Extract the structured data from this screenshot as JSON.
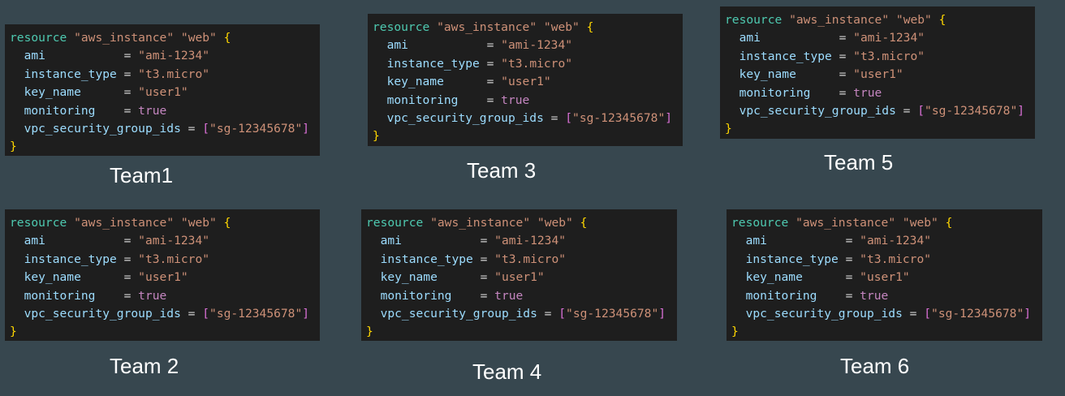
{
  "colors": {
    "background": "#37474f",
    "panel": "#1e1e1e",
    "keyword": "#4ec9b0",
    "identifier": "#9cdcfe",
    "string": "#ce9178",
    "boolean": "#c586c0",
    "brace": "#ffd700",
    "bracket": "#da70d6",
    "caption": "#ffffff"
  },
  "code": {
    "kw_resource": "resource",
    "type_str": "\"aws_instance\"",
    "name_str": "\"web\"",
    "open_brace": "{",
    "close_brace": "}",
    "k_ami": "ami",
    "eq_ami": "           = ",
    "v_ami": "\"ami-1234\"",
    "k_type": "instance_type",
    "eq_type": " = ",
    "v_type": "\"t3.micro\"",
    "k_key": "key_name",
    "eq_key": "      = ",
    "v_key": "\"user1\"",
    "k_mon": "monitoring",
    "eq_mon": "    = ",
    "v_mon": "true",
    "k_vpc": "vpc_security_group_ids",
    "eq_vpc": " = ",
    "br_open": "[",
    "v_vpc": "\"sg-12345678\"",
    "br_close": "]"
  },
  "teams": [
    {
      "caption": "Team1"
    },
    {
      "caption": "Team 2"
    },
    {
      "caption": "Team 3"
    },
    {
      "caption": "Team 4"
    },
    {
      "caption": "Team 5"
    },
    {
      "caption": "Team 6"
    }
  ]
}
